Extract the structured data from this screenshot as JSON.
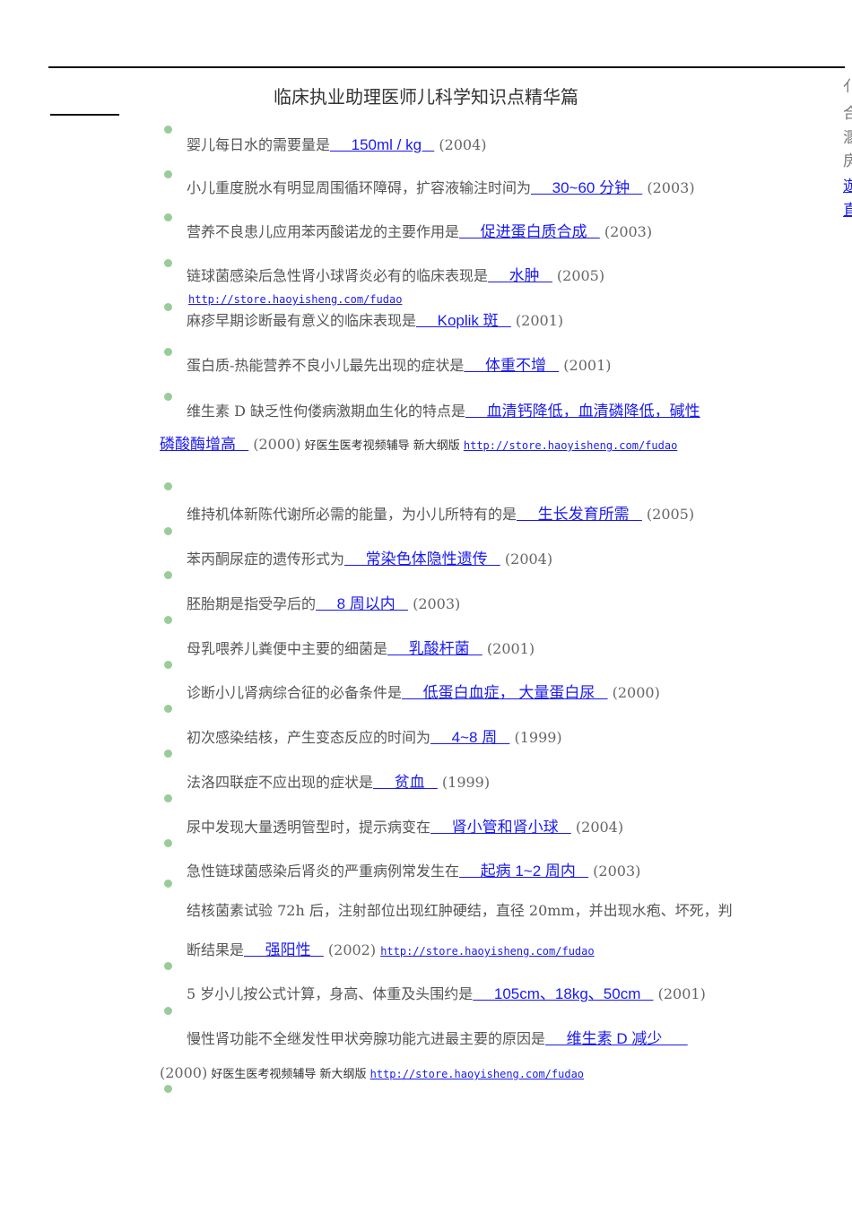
{
  "title": "临床执业助理医师儿科学知识点精华篇",
  "side_fragments": [
    "亻",
    "合",
    "溷",
    "房",
    "遊",
    "直"
  ],
  "promo": "好医生医考视频辅导 新大纲版",
  "url": "http://store.haoyisheng.com/fudao",
  "items": [
    {
      "q": "婴儿每日水的需要量是",
      "a": "150ml / kg",
      "y": "(2004)"
    },
    {
      "q": "小儿重度脱水有明显周围循环障碍，扩容液输注时间为",
      "a": "30~60 分钟",
      "y": "(2003)"
    },
    {
      "q": "营养不良患儿应用苯丙酸诺龙的主要作用是",
      "a": "促进蛋白质合成",
      "y": "(2003)"
    },
    {
      "q": "链球菌感染后急性肾小球肾炎必有的临床表现是",
      "a": "水肿",
      "y": "(2005)"
    },
    {
      "q": "麻疹早期诊断最有意义的临床表现是",
      "a": "Koplik 斑",
      "y": "(2001)"
    },
    {
      "q": "蛋白质-热能营养不良小儿最先出现的症状是",
      "a": "体重不增",
      "y": "(2001)"
    },
    {
      "q": "维生素 D 缺乏性佝偻病激期血生化的特点是",
      "a": "血清钙降低，血清磷降低，碱性",
      "a2": "磷酸酶增高",
      "y": "(2000)"
    },
    {
      "q": "维持机体新陈代谢所必需的能量，为小儿所特有的是",
      "a": "生长发育所需",
      "y": "(2005)"
    },
    {
      "q": "苯丙酮尿症的遗传形式为",
      "a": "常染色体隐性遗传",
      "y": "(2004)"
    },
    {
      "q": "胚胎期是指受孕后的",
      "a": "8 周以内",
      "y": "(2003)"
    },
    {
      "q": "母乳喂养儿粪便中主要的细菌是",
      "a": "乳酸杆菌",
      "y": "(2001)"
    },
    {
      "q": "诊断小儿肾病综合征的必备条件是",
      "a": "低蛋白血症， 大量蛋白尿",
      "y": "(2000)"
    },
    {
      "q": "初次感染结核，产生变态反应的时间为",
      "a": "4~8 周",
      "y": "(1999)"
    },
    {
      "q": "法洛四联症不应出现的症状是",
      "a": "贫血",
      "y": "(1999)"
    },
    {
      "q": "尿中发现大量透明管型时，提示病变在",
      "a": "肾小管和肾小球",
      "y": "(2004)"
    },
    {
      "q": "急性链球菌感染后肾炎的严重病例常发生在",
      "a": "起病 1~2 周内",
      "y": "(2003)"
    },
    {
      "q": "结核菌素试验 72h 后，注射部位出现红肿硬结，直径 20mm，并出现水疱、坏死，判",
      "q2": "断结果是",
      "a": "强阳性",
      "y": "(2002)"
    },
    {
      "q": "5 岁小儿按公式计算，身高、体重及头围约是",
      "a": "105cm、18kg、50cm",
      "y": "(2001)"
    },
    {
      "q": "慢性肾功能不全继发性甲状旁腺功能亢进最主要的原因是",
      "a": "维生素 D 减少",
      "y": "(2000)"
    }
  ]
}
